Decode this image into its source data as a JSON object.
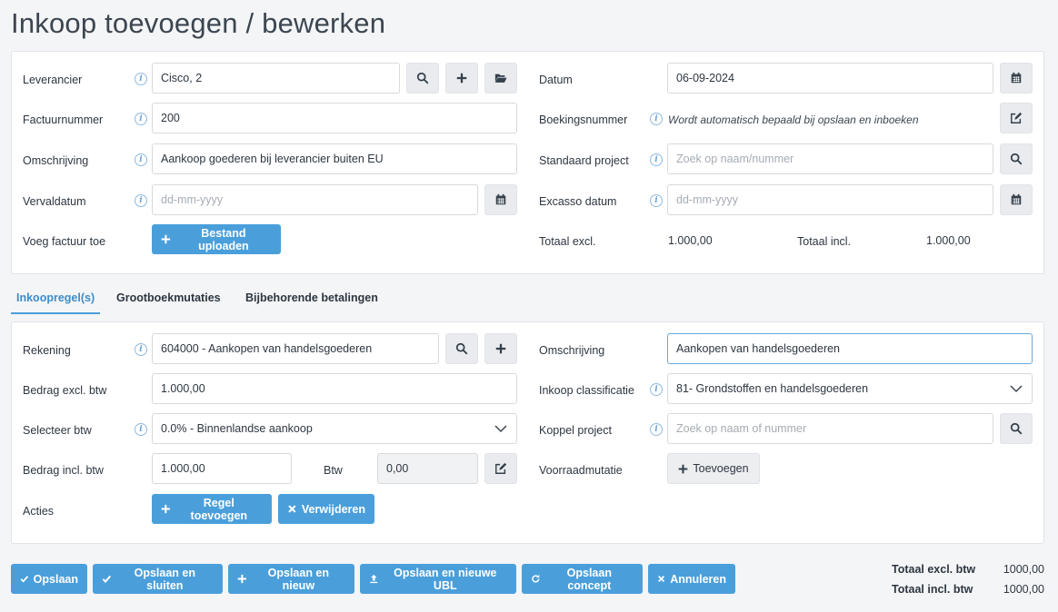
{
  "page": {
    "title": "Inkoop toevoegen / bewerken"
  },
  "top": {
    "supplier": {
      "label": "Leverancier",
      "value": "Cisco, 2"
    },
    "invoice_number": {
      "label": "Factuurnummer",
      "value": "200"
    },
    "description": {
      "label": "Omschrijving",
      "value": "Aankoop goederen bij leverancier buiten EU"
    },
    "due_date": {
      "label": "Vervaldatum",
      "placeholder": "dd-mm-yyyy"
    },
    "add_invoice": {
      "label": "Voeg factuur toe",
      "button": "Bestand uploaden"
    },
    "date": {
      "label": "Datum",
      "value": "06-09-2024"
    },
    "booking_number": {
      "label": "Boekingsnummer",
      "hint": "Wordt automatisch bepaald bij opslaan en inboeken"
    },
    "default_project": {
      "label": "Standaard project",
      "placeholder": "Zoek op naam/nummer"
    },
    "excasso_date": {
      "label": "Excasso datum",
      "placeholder": "dd-mm-yyyy"
    },
    "total_excl": {
      "label": "Totaal excl.",
      "value": "1.000,00"
    },
    "total_incl": {
      "label": "Totaal incl.",
      "value": "1.000,00"
    }
  },
  "tabs": [
    {
      "label": "Inkoopregel(s)",
      "active": true
    },
    {
      "label": "Grootboekmutaties",
      "active": false
    },
    {
      "label": "Bijbehorende betalingen",
      "active": false
    }
  ],
  "line": {
    "account": {
      "label": "Rekening",
      "value": "604000 - Aankopen van handelsgoederen"
    },
    "amount_excl": {
      "label": "Bedrag excl. btw",
      "value": "1.000,00"
    },
    "vat_select": {
      "label": "Selecteer btw",
      "value": "0.0% - Binnenlandse aankoop"
    },
    "amount_incl": {
      "label": "Bedrag incl. btw",
      "value": "1.000,00"
    },
    "vat": {
      "label": "Btw",
      "value": "0,00"
    },
    "actions": {
      "label": "Acties",
      "add": "Regel toevoegen",
      "delete": "Verwijderen"
    },
    "description": {
      "label": "Omschrijving",
      "value": "Aankopen van handelsgoederen"
    },
    "classification": {
      "label": "Inkoop classificatie",
      "value": "81- Grondstoffen en handelsgoederen"
    },
    "link_project": {
      "label": "Koppel project",
      "placeholder": "Zoek op naam of nummer"
    },
    "stock_mutation": {
      "label": "Voorraadmutatie",
      "button": "Toevoegen"
    }
  },
  "footer": {
    "buttons": {
      "save": "Opslaan",
      "save_close": "Opslaan en sluiten",
      "save_new": "Opslaan en nieuw",
      "save_new_ubl": "Opslaan en nieuwe UBL",
      "save_concept": "Opslaan concept",
      "cancel": "Annuleren"
    },
    "total_excl": {
      "label": "Totaal excl. btw",
      "value": "1000,00"
    },
    "total_incl": {
      "label": "Totaal incl. btw",
      "value": "1000,00"
    }
  },
  "colors": {
    "primary": "#4a9fdb",
    "icon_button": "#e9ebee",
    "info_icon": "#6ea3d2"
  }
}
